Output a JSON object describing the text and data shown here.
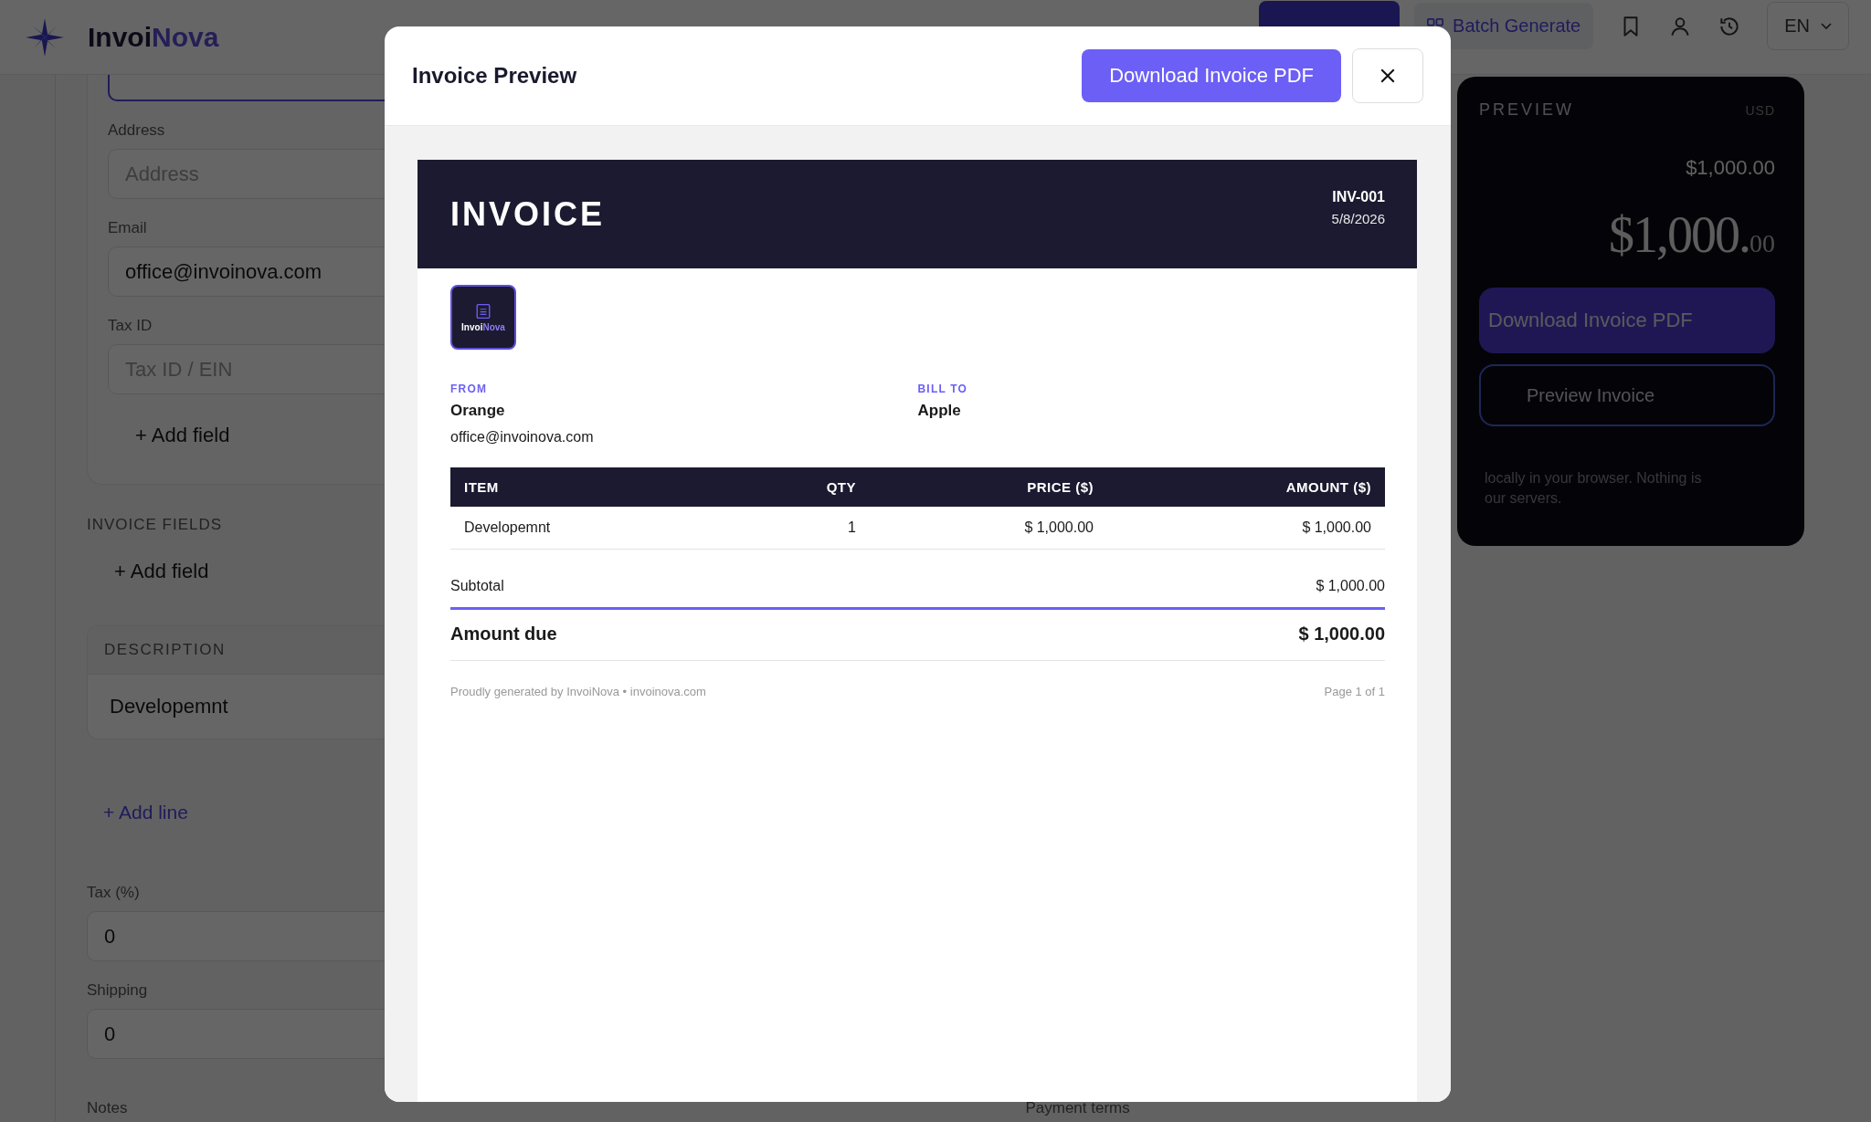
{
  "header": {
    "brand_first": "Invoi",
    "brand_second": "Nova",
    "batch": "Batch Generate",
    "language": "EN"
  },
  "form": {
    "sender_fields": [
      {
        "focused": true
      },
      {
        "label": "Address",
        "placeholder": "Address",
        "focused": false
      },
      {
        "label": "Email",
        "value": "office@invoinova.com",
        "focused": false
      },
      {
        "label": "Tax ID",
        "placeholder": "Tax ID / EIN",
        "focused": false
      }
    ],
    "sender_add_field": "+ Add field",
    "invoice_fields_heading": "INVOICE FIELDS",
    "invoice_add_field": "+ Add field",
    "line_items": {
      "column": "DESCRIPTION",
      "rows": [
        "Developemnt"
      ]
    },
    "add_line": "+ Add line",
    "totals_fields": [
      {
        "label": "Tax (%)",
        "value": "0"
      },
      {
        "label": "Shipping",
        "value": "0"
      }
    ],
    "notes_label": "Notes",
    "payment_terms_label": "Payment terms"
  },
  "panel": {
    "heading": "PREVIEW",
    "currency": "USD",
    "subtotal": "$1,000.00",
    "total_main": "$1,000.",
    "total_cents": "00",
    "download": "Download Invoice PDF",
    "preview": "Preview Invoice",
    "note_lines": [
      "locally in your browser. Nothing is",
      "our servers."
    ]
  },
  "modal": {
    "title": "Invoice Preview",
    "download": "Download Invoice PDF",
    "invoice": {
      "title": "INVOICE",
      "number": "INV-001",
      "date": "5/8/2026",
      "logo_first": "Invoi",
      "logo_second": "Nova",
      "from_label": "FROM",
      "from_name": "Orange",
      "from_email": "office@invoinova.com",
      "to_label": "BILL TO",
      "to_name": "Apple",
      "columns": [
        "ITEM",
        "QTY",
        "PRICE ($)",
        "AMOUNT ($)"
      ],
      "rows": [
        [
          "Developemnt",
          "1",
          "$ 1,000.00",
          "$ 1,000.00"
        ]
      ],
      "subtotal_label": "Subtotal",
      "subtotal": "$ 1,000.00",
      "due_label": "Amount due",
      "due": "$ 1,000.00",
      "footer": "Proudly generated by InvoiNova • invoinova.com",
      "page": "Page 1 of 1"
    }
  }
}
